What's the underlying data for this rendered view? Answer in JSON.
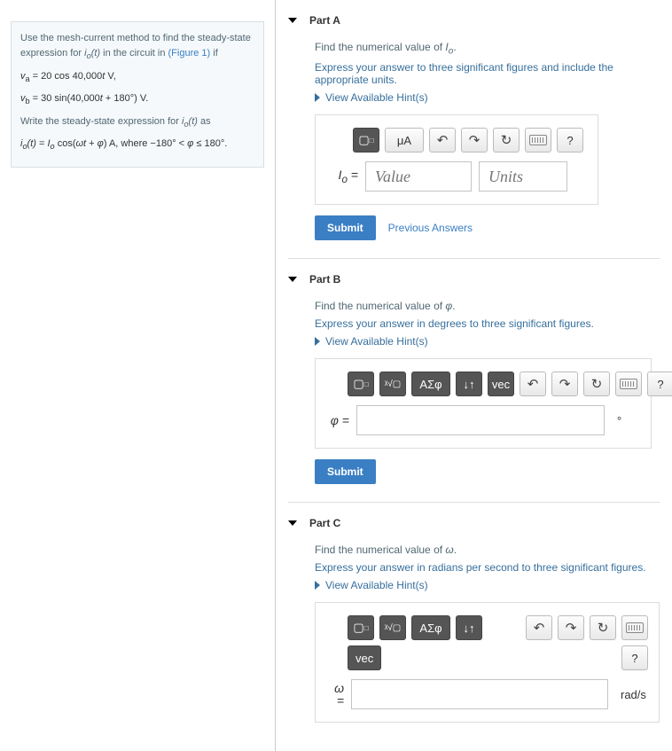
{
  "prompt": {
    "line1_a": "Use the mesh-current method to find the steady-state expression for ",
    "line1_b": " in the circuit in ",
    "figure_link": "(Figure 1)",
    "line1_c": " if",
    "va_eq": "vₐ = 20 cos 40,000t V,",
    "vb_eq": "v_b = 30 sin(40,000t + 180°) V.",
    "line2_a": "Write the steady-state expression for ",
    "line2_b": " as",
    "io_eq": "i_o(t) = I_o cos(ωt + φ) A, where −180° < φ ≤ 180°."
  },
  "parts": {
    "A": {
      "title": "Part A",
      "find": "Find the numerical value of I_o.",
      "instruct": "Express your answer to three significant figures and include the appropriate units.",
      "hints": "View Available Hint(s)",
      "label": "I_o =",
      "value_ph": "Value",
      "units_ph": "Units",
      "submit": "Submit",
      "prev": "Previous Answers",
      "tool_units": "μA",
      "tool_help": "?"
    },
    "B": {
      "title": "Part B",
      "find": "Find the numerical value of φ.",
      "instruct": "Express your answer in degrees to three significant figures.",
      "hints": "View Available Hint(s)",
      "label": "φ =",
      "unit_suffix": "°",
      "submit": "Submit",
      "tool_greek": "ΑΣφ",
      "tool_arrows": "↓↑",
      "tool_vec": "vec",
      "tool_help": "?"
    },
    "C": {
      "title": "Part C",
      "find": "Find the numerical value of ω.",
      "instruct": "Express your answer in radians per second to three significant figures.",
      "hints": "View Available Hint(s)",
      "label": "ω =",
      "unit_suffix": "rad/s",
      "tool_greek": "ΑΣφ",
      "tool_arrows": "↓↑",
      "tool_vec": "vec",
      "tool_help": "?"
    }
  },
  "icons": {
    "sqrt": "ᵡ√▢",
    "template": "▢⁰▢"
  }
}
